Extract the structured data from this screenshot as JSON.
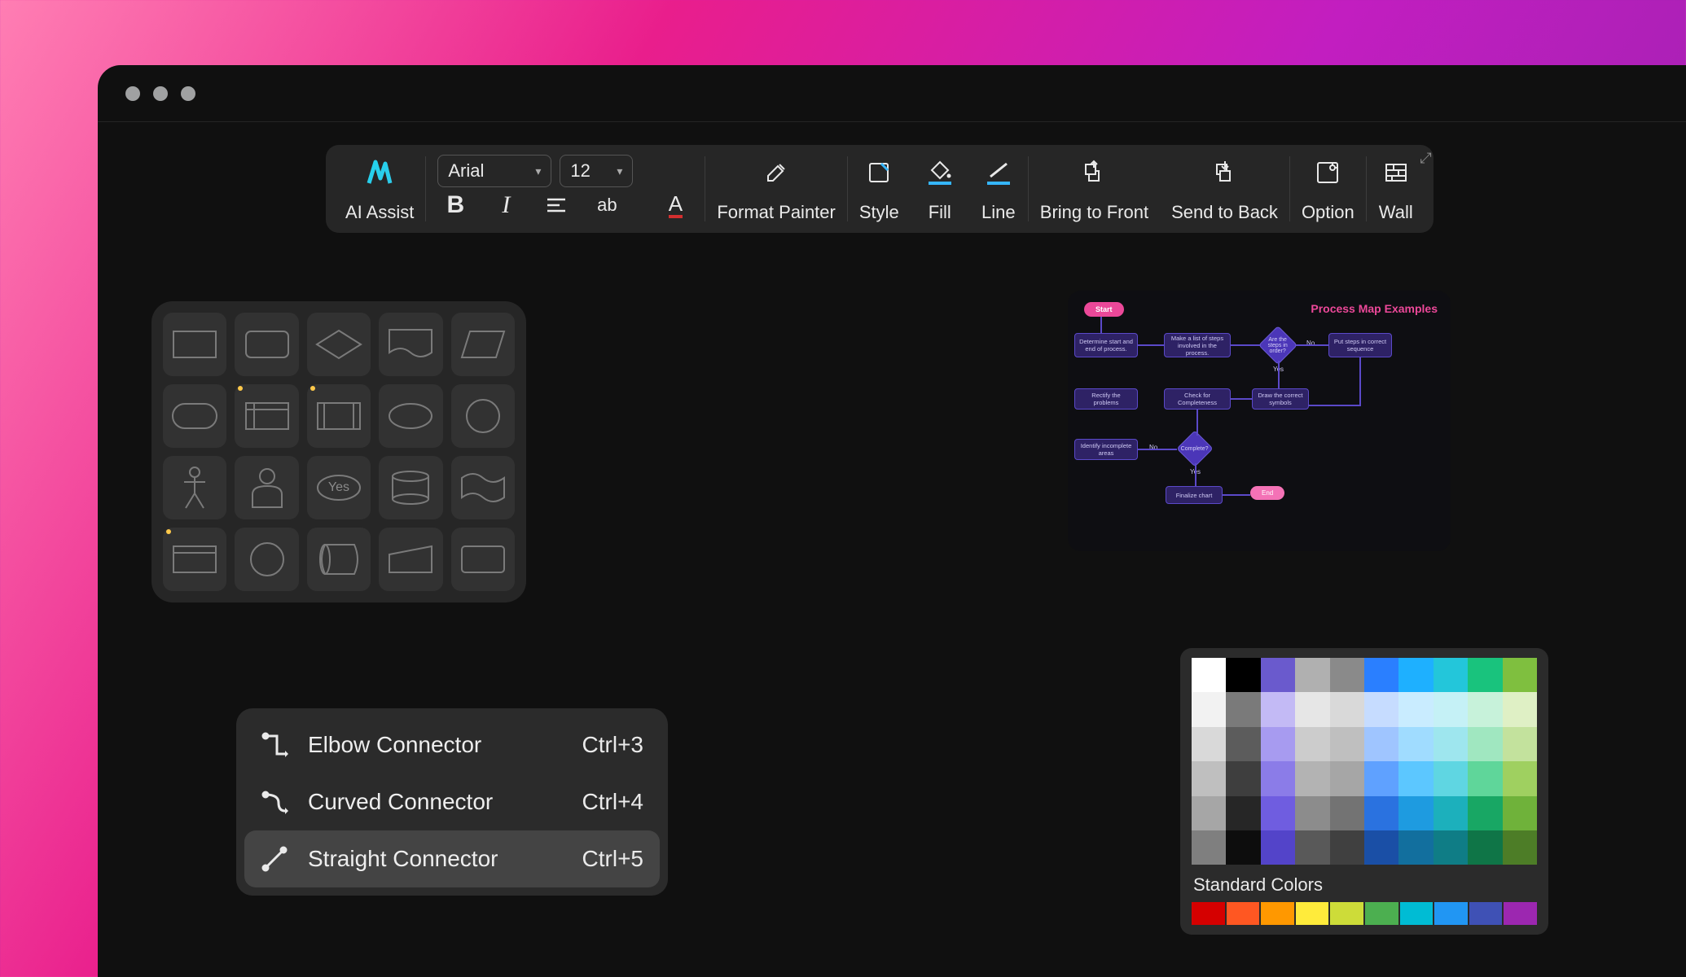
{
  "toolbar": {
    "ai_assist": "AI Assist",
    "font_family": "Arial",
    "font_size": "12",
    "format_painter": "Format Painter",
    "style": "Style",
    "fill": "Fill",
    "line": "Line",
    "bring_to_front": "Bring to Front",
    "send_to_back": "Send to Back",
    "option": "Option",
    "wall": "Wall"
  },
  "shape_palette": {
    "shapes": [
      "rectangle",
      "card",
      "diamond",
      "document",
      "parallelogram",
      "rounded-rectangle",
      "subprocess",
      "predefined-process",
      "ellipse",
      "circle",
      "actor",
      "user",
      "decision-yes",
      "cylinder",
      "flag",
      "internal-storage",
      "circle-outline",
      "database",
      "manual-input",
      "container"
    ],
    "decision_label": "Yes"
  },
  "connector_menu": {
    "items": [
      {
        "label": "Elbow Connector",
        "shortcut": "Ctrl+3",
        "icon": "elbow"
      },
      {
        "label": "Curved Connector",
        "shortcut": "Ctrl+4",
        "icon": "curved"
      },
      {
        "label": "Straight Connector",
        "shortcut": "Ctrl+5",
        "icon": "straight",
        "selected": true
      }
    ]
  },
  "flowchart_preview": {
    "title": "Process Map Examples",
    "nodes": {
      "start": "Start",
      "determine": "Determine start and end of process.",
      "makelist": "Make a list of steps involved in the process.",
      "order_q": "Are the steps in order?",
      "putorder": "Put steps in correct sequence",
      "rectify": "Rectify the problems",
      "check": "Check for Completeness",
      "draw": "Draw the correct symbols",
      "identify": "Identify incomplete areas",
      "complete_q": "Complete?",
      "finalize": "Finalize chart",
      "end": "End"
    },
    "labels": {
      "yes": "Yes",
      "no": "No"
    }
  },
  "color_panel": {
    "standard_heading": "Standard Colors",
    "theme_grid": [
      [
        "#ffffff",
        "#000000",
        "#6a5acd",
        "#b0b0b0",
        "#8a8a8a",
        "#2a7fff",
        "#1eb0ff",
        "#23c6da",
        "#19c37d",
        "#7fbf3f"
      ],
      [
        "#f2f2f2",
        "#7a7a7a",
        "#c3baf5",
        "#e6e6e6",
        "#d9d9d9",
        "#c6dcff",
        "#c9ecff",
        "#c5f1f6",
        "#c7f2da",
        "#dff0c5"
      ],
      [
        "#d9d9d9",
        "#5c5c5c",
        "#a79bf0",
        "#cccccc",
        "#bfbfbf",
        "#9fc5ff",
        "#a0dcff",
        "#9ee6ee",
        "#a0e7c0",
        "#c3e29d"
      ],
      [
        "#bfbfbf",
        "#3e3e3e",
        "#8b7ce8",
        "#b3b3b3",
        "#a6a6a6",
        "#5fa1ff",
        "#5cc7ff",
        "#5fd6e2",
        "#5fd69a",
        "#9fd060"
      ],
      [
        "#a6a6a6",
        "#262626",
        "#6f5de0",
        "#8c8c8c",
        "#737373",
        "#2a72e0",
        "#1e9be0",
        "#1cb0bc",
        "#18a764",
        "#6fb23a"
      ],
      [
        "#7f7f7f",
        "#0d0d0d",
        "#5344c9",
        "#595959",
        "#404040",
        "#1a4fa6",
        "#126f9e",
        "#0f7d86",
        "#0f7547",
        "#4d7d27"
      ]
    ],
    "standard_colors": [
      "#d50000",
      "#ff5722",
      "#ff9800",
      "#ffeb3b",
      "#cddc39",
      "#4caf50",
      "#00bcd4",
      "#2196f3",
      "#3f51b5",
      "#9c27b0"
    ]
  }
}
